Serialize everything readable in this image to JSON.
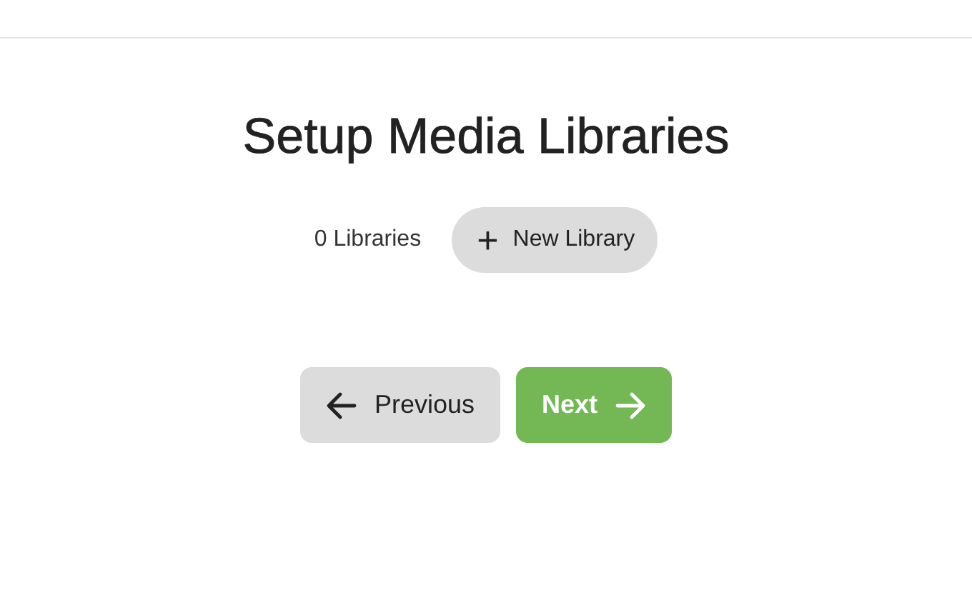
{
  "title": "Setup Media Libraries",
  "library_count": "0 Libraries",
  "new_library_button": {
    "icon": "+",
    "label": "New Library"
  },
  "nav_buttons": [
    {
      "kind": "previous",
      "label": "Previous"
    },
    {
      "kind": "next",
      "label": "Next"
    }
  ]
}
